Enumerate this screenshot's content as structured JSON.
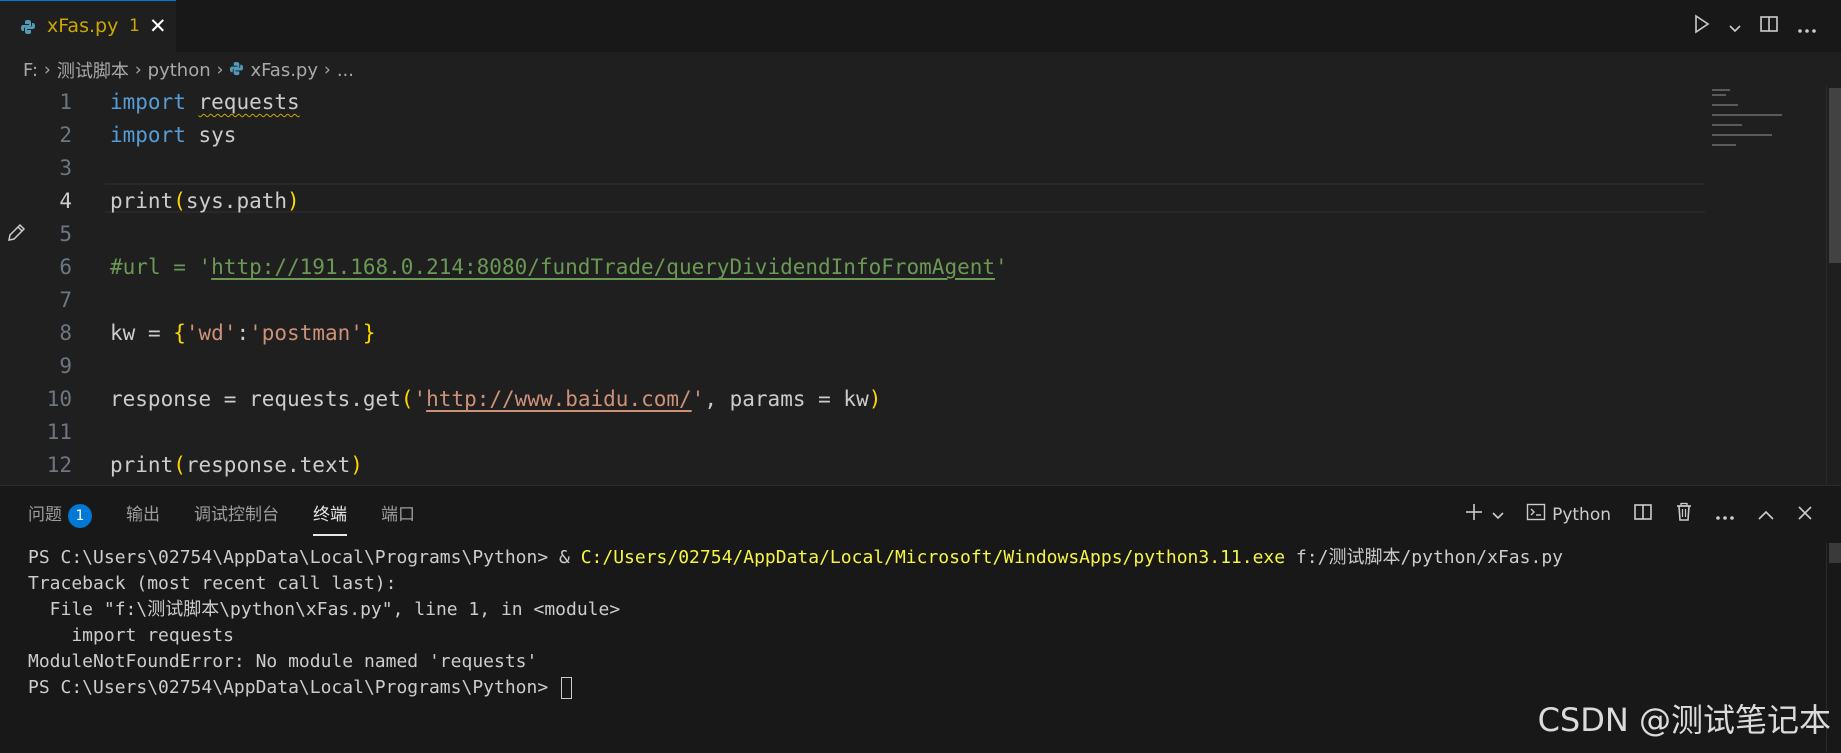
{
  "tab": {
    "filename": "xFas.py",
    "problem_count": "1",
    "close": "✕"
  },
  "breadcrumb": {
    "drive": "F:",
    "folder1": "测试脚本",
    "folder2": "python",
    "file": "xFas.py",
    "more": "..."
  },
  "editor": {
    "line_numbers": [
      "1",
      "2",
      "3",
      "4",
      "5",
      "6",
      "7",
      "8",
      "9",
      "10",
      "11",
      "12"
    ],
    "active_line": "4",
    "code": {
      "l1_kw": "import",
      "l1_mod": "requests",
      "l2_kw": "import",
      "l2_mod": "sys",
      "l4_fn": "print",
      "l4_arg": "sys.path",
      "l6_comment_pre": "#url = '",
      "l6_url": "http://191.168.0.214:8080/fundTrade/queryDividendInfoFromAgent",
      "l6_comment_post": "'",
      "l8_var": "kw",
      "l8_op": " = ",
      "l8_key": "'wd'",
      "l8_colon": ":",
      "l8_val": "'postman'",
      "l10_var": "response",
      "l10_op": " = ",
      "l10_obj": "requests",
      "l10_fn": "get",
      "l10_q1": "'",
      "l10_url": "http://www.baidu.com/",
      "l10_q2": "'",
      "l10_sep": ", ",
      "l10_param": "params",
      "l10_eq": " = ",
      "l10_arg": "kw",
      "l12_fn": "print",
      "l12_arg": "response.text"
    }
  },
  "panel": {
    "tabs": [
      {
        "label": "问题",
        "badge": "1"
      },
      {
        "label": "输出"
      },
      {
        "label": "调试控制台"
      },
      {
        "label": "终端"
      },
      {
        "label": "端口"
      }
    ],
    "active_tab": "终端",
    "shell_label": "Python",
    "terminal": {
      "l1_prompt": "PS C:\\Users\\02754\\AppData\\Local\\Programs\\Python> & ",
      "l1_exe": "C:/Users/02754/AppData/Local/Microsoft/WindowsApps/python3.11.exe",
      "l1_arg": " f:/测试脚本/python/xFas.py",
      "l2": "Traceback (most recent call last):",
      "l3": "  File \"f:\\测试脚本\\python\\xFas.py\", line 1, in <module>",
      "l4": "    import requests",
      "l5": "ModuleNotFoundError: No module named 'requests'",
      "l6_prompt": "PS C:\\Users\\02754\\AppData\\Local\\Programs\\Python> "
    }
  },
  "watermark": "CSDN @测试笔记本",
  "icons": {
    "python": "python-file-icon",
    "run": "run-icon",
    "split": "split-editor-icon",
    "more": "more-actions-icon",
    "edit": "pencil-icon",
    "plus": "new-terminal-icon",
    "terminal": "terminal-icon",
    "trash": "trash-icon",
    "maximize": "chevron-up-icon",
    "close": "close-icon"
  },
  "colors": {
    "accent": "#0078d4",
    "warning": "#cca700",
    "keyword": "#569cd6",
    "string": "#ce9178",
    "comment": "#6a9955"
  }
}
